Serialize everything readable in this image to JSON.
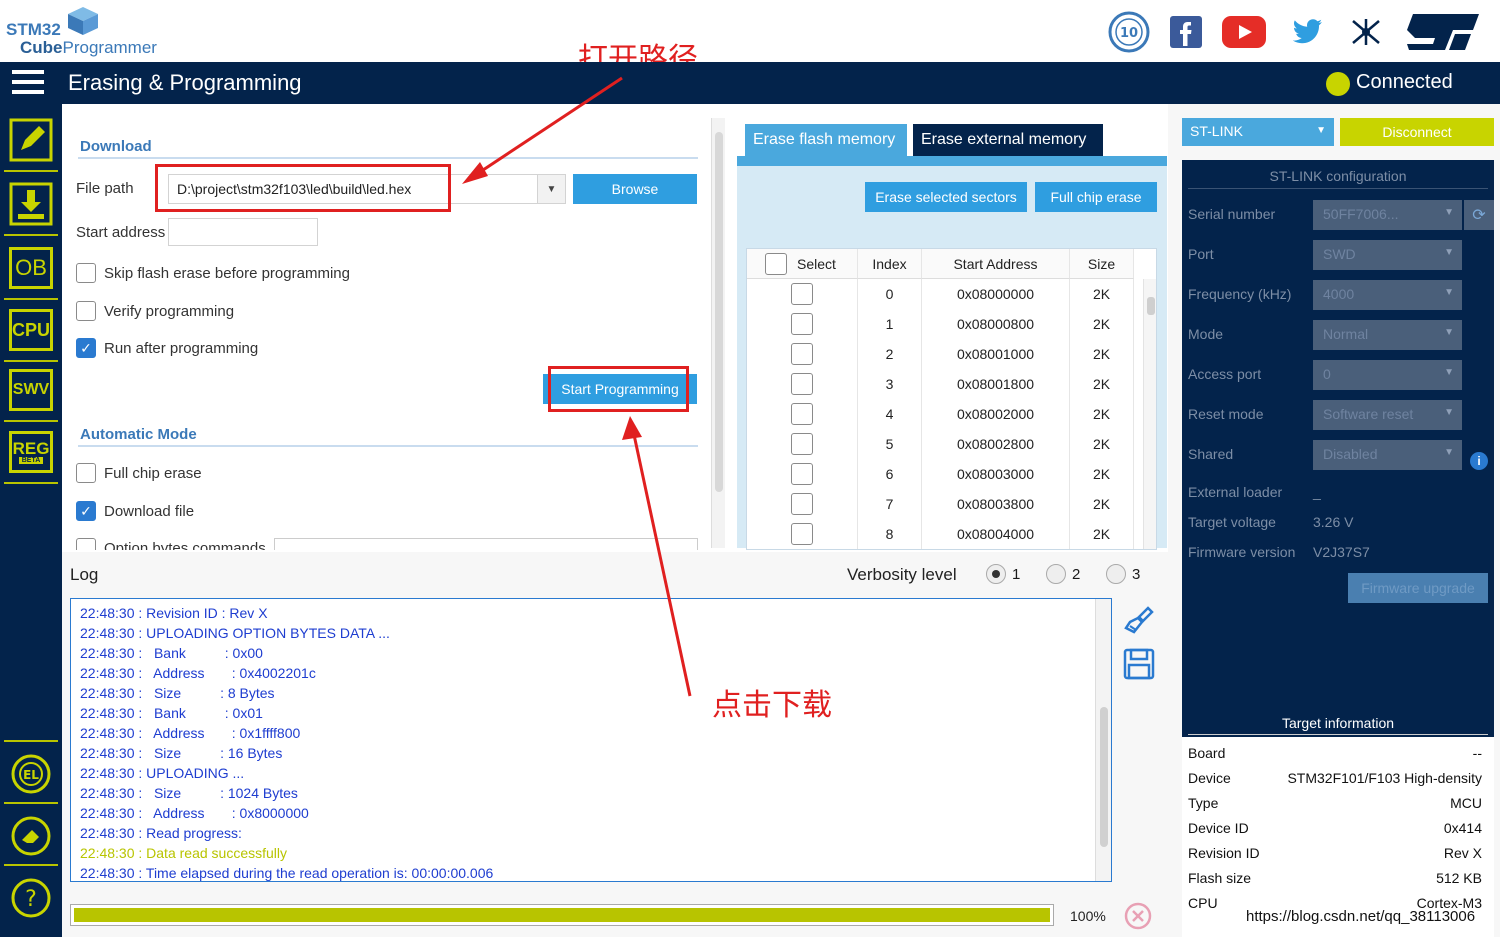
{
  "app": {
    "logo_stm32": "STM32",
    "logo_cube": "Cube",
    "logo_programmer": "Programmer",
    "page_title": "Erasing & Programming",
    "connection_status": "Connected",
    "connection_color": "#c8d400"
  },
  "social_icons": [
    "anniversary-badge-icon",
    "facebook-icon",
    "youtube-icon",
    "twitter-icon",
    "network-icon",
    "st-logo-icon"
  ],
  "sidebar": {
    "items": [
      {
        "name": "erase-edit-icon",
        "label": ""
      },
      {
        "name": "download-icon",
        "label": ""
      },
      {
        "name": "ob",
        "label": "OB"
      },
      {
        "name": "cpu",
        "label": "CPU"
      },
      {
        "name": "swv",
        "label": "SWV"
      },
      {
        "name": "reg",
        "label": "REG"
      }
    ],
    "reg_beta": "BETA",
    "bottom_items": [
      "el-icon",
      "eraser-icon",
      "help-icon"
    ]
  },
  "download": {
    "section_title": "Download",
    "file_path_label": "File path",
    "file_path_value": "D:\\project\\stm32f103\\led\\build\\led.hex",
    "browse_label": "Browse",
    "start_address_label": "Start address",
    "start_address_value": "",
    "skip_erase_label": "Skip flash erase before programming",
    "skip_erase_checked": false,
    "verify_label": "Verify programming",
    "verify_checked": false,
    "run_after_label": "Run after programming",
    "run_after_checked": true,
    "start_programming_label": "Start Programming"
  },
  "automatic_mode": {
    "section_title": "Automatic Mode",
    "full_chip_erase_label": "Full chip erase",
    "download_file_label": "Download file",
    "option_bytes_label": "Option bytes commands"
  },
  "erase": {
    "tab_flash": "Erase flash memory",
    "tab_external": "Erase external memory",
    "erase_selected_label": "Erase selected sectors",
    "full_chip_erase_label": "Full chip erase",
    "columns": [
      "Select",
      "Index",
      "Start Address",
      "Size"
    ],
    "rows": [
      {
        "index": "0",
        "address": "0x08000000",
        "size": "2K"
      },
      {
        "index": "1",
        "address": "0x08000800",
        "size": "2K"
      },
      {
        "index": "2",
        "address": "0x08001000",
        "size": "2K"
      },
      {
        "index": "3",
        "address": "0x08001800",
        "size": "2K"
      },
      {
        "index": "4",
        "address": "0x08002000",
        "size": "2K"
      },
      {
        "index": "5",
        "address": "0x08002800",
        "size": "2K"
      },
      {
        "index": "6",
        "address": "0x08003000",
        "size": "2K"
      },
      {
        "index": "7",
        "address": "0x08003800",
        "size": "2K"
      },
      {
        "index": "8",
        "address": "0x08004000",
        "size": "2K"
      }
    ]
  },
  "stlink": {
    "interface": "ST-LINK",
    "disconnect_label": "Disconnect",
    "config_title": "ST-LINK configuration",
    "fields": [
      {
        "label": "Serial number",
        "value": "50FF7006..."
      },
      {
        "label": "Port",
        "value": "SWD"
      },
      {
        "label": "Frequency (kHz)",
        "value": "4000"
      },
      {
        "label": "Mode",
        "value": "Normal"
      },
      {
        "label": "Access port",
        "value": "0"
      },
      {
        "label": "Reset mode",
        "value": "Software reset"
      },
      {
        "label": "Shared",
        "value": "Disabled"
      }
    ],
    "external_loader_label": "External loader",
    "external_loader_value": "_",
    "target_voltage_label": "Target voltage",
    "target_voltage_value": "3.26 V",
    "firmware_version_label": "Firmware version",
    "firmware_version_value": "V2J37S7",
    "firmware_upgrade_label": "Firmware upgrade"
  },
  "target_info": {
    "title": "Target information",
    "rows": [
      {
        "label": "Board",
        "value": "--"
      },
      {
        "label": "Device",
        "value": "STM32F101/F103 High-density"
      },
      {
        "label": "Type",
        "value": "MCU"
      },
      {
        "label": "Device ID",
        "value": "0x414"
      },
      {
        "label": "Revision ID",
        "value": "Rev X"
      },
      {
        "label": "Flash size",
        "value": "512 KB"
      },
      {
        "label": "CPU",
        "value": "Cortex-M3"
      }
    ]
  },
  "log": {
    "title": "Log",
    "verbosity_label": "Verbosity level",
    "verbosity_options": [
      "1",
      "2",
      "3"
    ],
    "verbosity_selected": "1",
    "lines": [
      {
        "text": "22:48:30 : Revision ID : Rev X",
        "ok": false
      },
      {
        "text": "22:48:30 : UPLOADING OPTION BYTES DATA ...",
        "ok": false
      },
      {
        "text": "22:48:30 :   Bank          : 0x00",
        "ok": false
      },
      {
        "text": "22:48:30 :   Address       : 0x4002201c",
        "ok": false
      },
      {
        "text": "22:48:30 :   Size          : 8 Bytes",
        "ok": false
      },
      {
        "text": "22:48:30 :   Bank          : 0x01",
        "ok": false
      },
      {
        "text": "22:48:30 :   Address       : 0x1ffff800",
        "ok": false
      },
      {
        "text": "22:48:30 :   Size          : 16 Bytes",
        "ok": false
      },
      {
        "text": "22:48:30 : UPLOADING ...",
        "ok": false
      },
      {
        "text": "22:48:30 :   Size          : 1024 Bytes",
        "ok": false
      },
      {
        "text": "22:48:30 :   Address       : 0x8000000",
        "ok": false
      },
      {
        "text": "22:48:30 : Read progress:",
        "ok": false
      },
      {
        "text": "22:48:30 : Data read successfully",
        "ok": true
      },
      {
        "text": "22:48:30 : Time elapsed during the read operation is: 00:00:00.006",
        "ok": false
      }
    ],
    "progress_value": 1.0,
    "progress_text": "100%"
  },
  "annotations": {
    "open_path": "打开路径",
    "click_download": "点击下载"
  },
  "watermark": "https://blog.csdn.net/qq_38113006"
}
